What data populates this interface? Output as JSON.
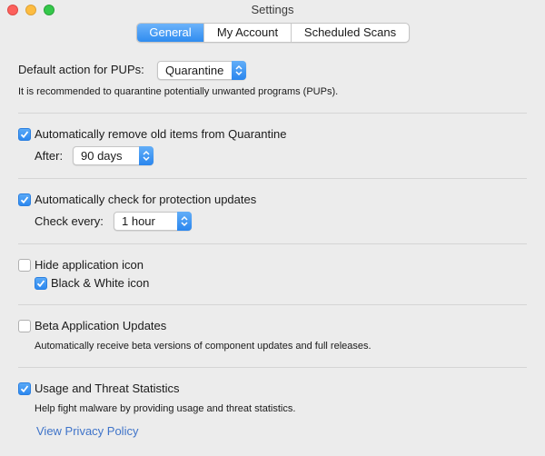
{
  "window": {
    "title": "Settings"
  },
  "tabs": [
    {
      "label": "General",
      "active": true
    },
    {
      "label": "My Account",
      "active": false
    },
    {
      "label": "Scheduled Scans",
      "active": false
    }
  ],
  "pups": {
    "label": "Default action for PUPs:",
    "value": "Quarantine",
    "description": "It is recommended to quarantine potentially unwanted programs (PUPs)."
  },
  "quarantine": {
    "checkbox_label": "Automatically remove old items from Quarantine",
    "checked": true,
    "after_label": "After:",
    "after_value": "90 days"
  },
  "updates": {
    "checkbox_label": "Automatically check for protection updates",
    "checked": true,
    "interval_label": "Check every:",
    "interval_value": "1 hour"
  },
  "app_icon": {
    "hide_label": "Hide application icon",
    "hide_checked": false,
    "bw_label": "Black & White icon",
    "bw_checked": true
  },
  "beta": {
    "checkbox_label": "Beta Application Updates",
    "checked": false,
    "description": "Automatically receive beta versions of component updates and full releases."
  },
  "stats": {
    "checkbox_label": "Usage and Threat Statistics",
    "checked": true,
    "description": "Help fight malware by providing usage and threat statistics.",
    "link_label": "View Privacy Policy"
  },
  "colors": {
    "accent": "#2f8cf0",
    "link": "#3f74c9"
  }
}
